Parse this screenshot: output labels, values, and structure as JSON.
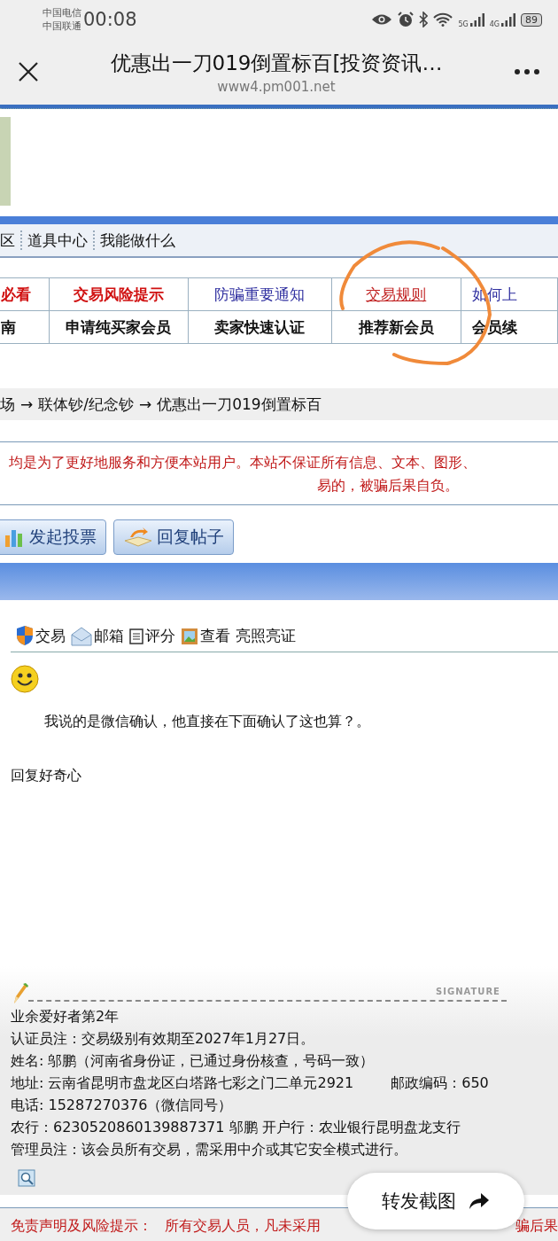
{
  "status_bar": {
    "carriers": [
      "中国电信",
      "中国联通"
    ],
    "time": "00:08",
    "network_labels": [
      "5G",
      "4G"
    ],
    "battery": "89"
  },
  "header": {
    "title": "优惠出一刀019倒置标百[投资资讯…",
    "url": "www4.pm001.net"
  },
  "nav": {
    "items": [
      "区",
      "道具中心",
      "我能做什么"
    ]
  },
  "link_table": {
    "rows": [
      [
        {
          "text": "必看",
          "kind": "alert"
        },
        {
          "text": "交易风险提示",
          "kind": "alert"
        },
        {
          "text": "防骗重要通知",
          "kind": "info"
        },
        {
          "text": "交易规则",
          "kind": "link"
        },
        {
          "text": "如何上",
          "kind": "info"
        }
      ],
      [
        {
          "text": "南",
          "kind": "plain"
        },
        {
          "text": "申请纯买家会员",
          "kind": "plain"
        },
        {
          "text": "卖家快速认证",
          "kind": "plain"
        },
        {
          "text": "推荐新会员",
          "kind": "plain"
        },
        {
          "text": "会员续",
          "kind": "plain"
        }
      ]
    ]
  },
  "breadcrumb": {
    "separator": "→",
    "items": [
      "场",
      "联体钞/纪念钞",
      "优惠出一刀019倒置标百"
    ]
  },
  "notice": [
    "均是为了更好地服务和方便本站用户。本站不保证所有信息、文本、图形、",
    "易的，被骗后果自负。"
  ],
  "actions": [
    {
      "label": "发起投票",
      "kind": "poll"
    },
    {
      "label": "回复帖子",
      "kind": "reply"
    }
  ],
  "post": {
    "tools": [
      {
        "label": "交易",
        "kind": "shield"
      },
      {
        "label": "邮箱",
        "kind": "mail"
      },
      {
        "label": "评分",
        "kind": "note"
      },
      {
        "label": "查看",
        "kind": "picture"
      },
      {
        "label": "亮照亮证",
        "kind": "none"
      }
    ],
    "body": "我说的是微信确认，他直接在下面确认了这也算？。",
    "reply_to": "回复好奇心",
    "signature_label": "SIGNATURE",
    "signature": [
      {
        "text": "业余爱好者第2年"
      },
      {
        "text": "认证员注：交易级别有效期至2027年1月27日。"
      },
      {
        "text": "姓名: 邬鹏（河南省身份证，已通过身份核查，号码一致）"
      },
      {
        "text": "地址: 云南省昆明市盘龙区白塔路七彩之门二单元2921",
        "extra": "邮政编码：650"
      },
      {
        "text": "电话: 15287270376（微信同号）"
      },
      {
        "text": "农行：6230520860139887371  邬鹏   开户行：农业银行昆明盘龙支行"
      },
      {
        "text": "管理员注：该会员所有交易，需采用中介或其它安全模式进行。"
      }
    ]
  },
  "disclaimer": {
    "label": "免责声明及风险提示：",
    "text": "所有交易人员，凡未采用",
    "tail": "骗后果"
  },
  "share_button": {
    "label": "转发截图"
  }
}
